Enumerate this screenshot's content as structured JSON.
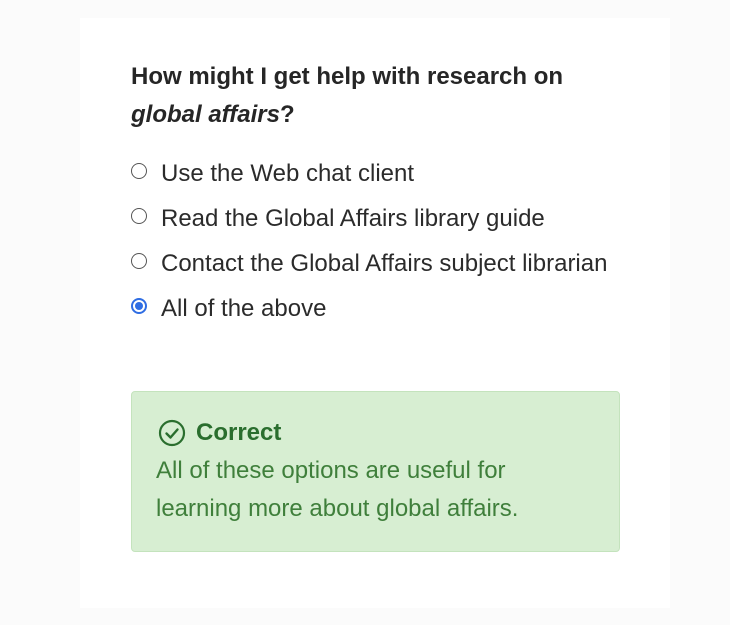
{
  "question": {
    "text_before": "How might I get help with research on ",
    "emphasis": "global affairs",
    "text_after": "?"
  },
  "options": [
    {
      "label": "Use the Web chat client",
      "selected": false
    },
    {
      "label": "Read the Global Affairs library guide",
      "selected": false
    },
    {
      "label": "Contact the Global Affairs subject librarian",
      "selected": false
    },
    {
      "label": "All of the above",
      "selected": true
    }
  ],
  "feedback": {
    "icon": "check-circle-icon",
    "title": "Correct",
    "message": "All of these options are useful for learning more about global affairs.",
    "colors": {
      "background": "#d7eed2",
      "text": "#3f7f3b"
    }
  },
  "colors": {
    "radio_selected": "#2f6de3"
  }
}
